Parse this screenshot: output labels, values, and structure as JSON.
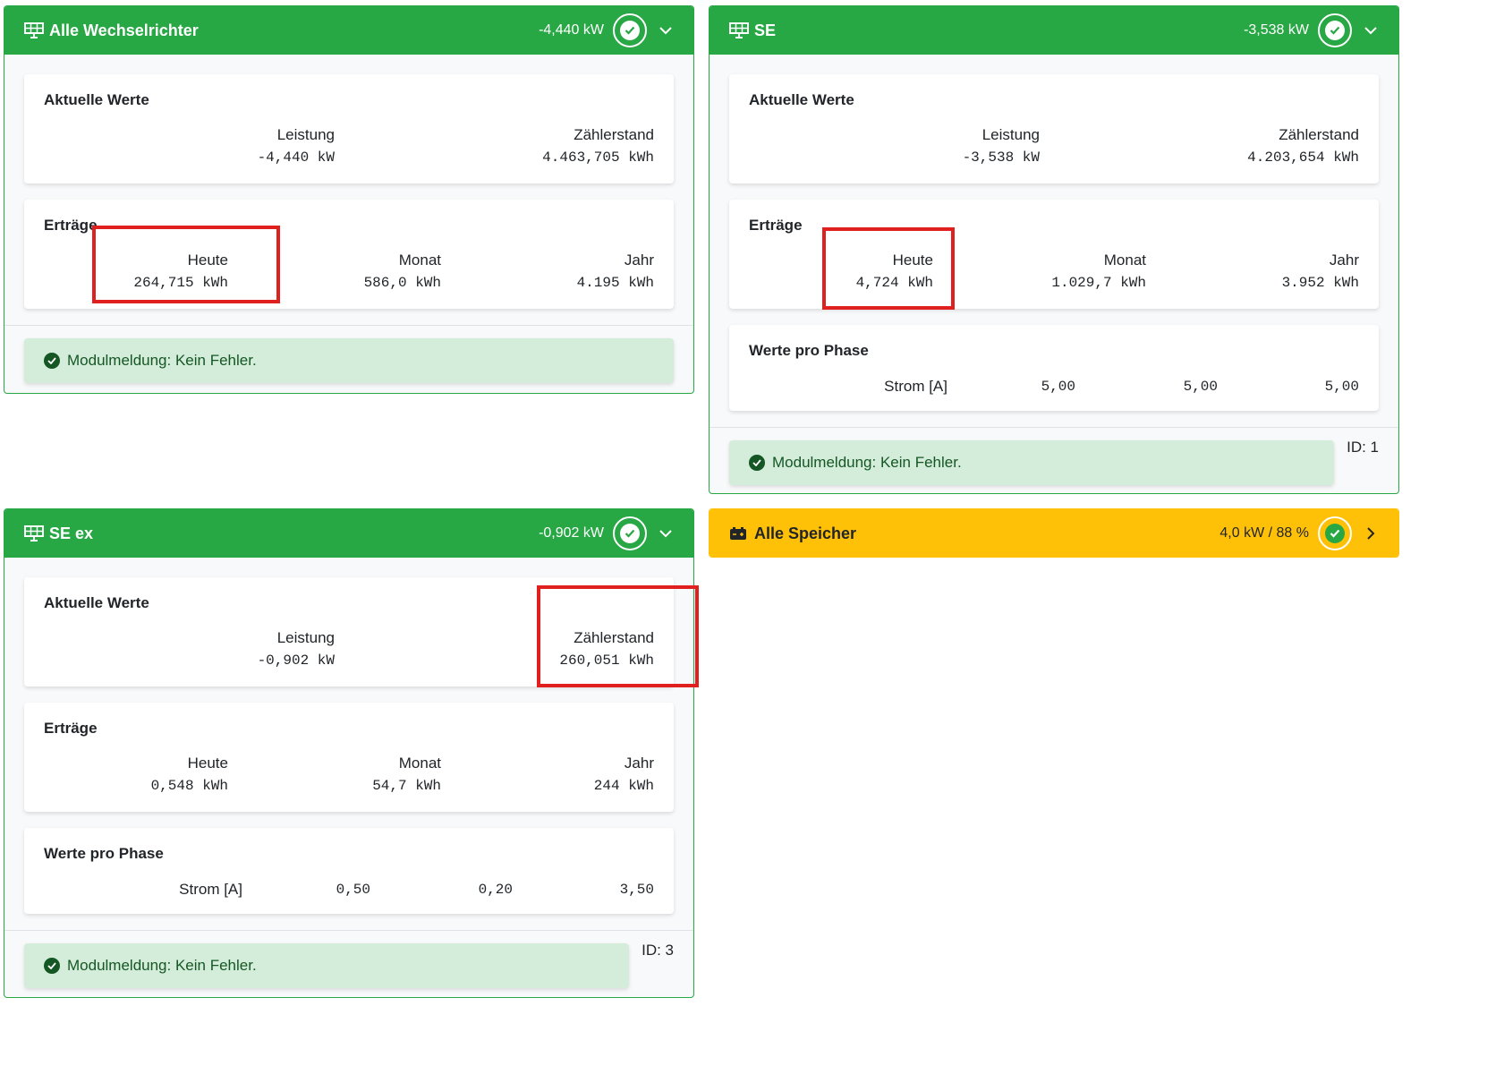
{
  "cards": {
    "all_inverters": {
      "title": "Alle Wechselrichter",
      "power": "-4,440 kW",
      "current": {
        "title": "Aktuelle Werte",
        "power_label": "Leistung",
        "power_value": "-4,440 kW",
        "meter_label": "Zählerstand",
        "meter_value": "4.463,705 kWh"
      },
      "yields": {
        "title": "Erträge",
        "today_label": "Heute",
        "today_value": "264,715 kWh",
        "month_label": "Monat",
        "month_value": "586,0 kWh",
        "year_label": "Jahr",
        "year_value": "4.195 kWh"
      },
      "message": "Modulmeldung: Kein Fehler."
    },
    "se": {
      "title": "SE",
      "power": "-3,538 kW",
      "current": {
        "title": "Aktuelle Werte",
        "power_label": "Leistung",
        "power_value": "-3,538 kW",
        "meter_label": "Zählerstand",
        "meter_value": "4.203,654 kWh"
      },
      "yields": {
        "title": "Erträge",
        "today_label": "Heute",
        "today_value": "4,724 kWh",
        "month_label": "Monat",
        "month_value": "1.029,7 kWh",
        "year_label": "Jahr",
        "year_value": "3.952 kWh"
      },
      "phases": {
        "title": "Werte pro Phase",
        "label": "Strom [A]",
        "values": [
          "5,00",
          "5,00",
          "5,00"
        ]
      },
      "message": "Modulmeldung: Kein Fehler.",
      "id": "ID: 1"
    },
    "se_ex": {
      "title": "SE ex",
      "power": "-0,902 kW",
      "current": {
        "title": "Aktuelle Werte",
        "power_label": "Leistung",
        "power_value": "-0,902 kW",
        "meter_label": "Zählerstand",
        "meter_value": "260,051 kWh"
      },
      "yields": {
        "title": "Erträge",
        "today_label": "Heute",
        "today_value": "0,548 kWh",
        "month_label": "Monat",
        "month_value": "54,7 kWh",
        "year_label": "Jahr",
        "year_value": "244 kWh"
      },
      "phases": {
        "title": "Werte pro Phase",
        "label": "Strom [A]",
        "values": [
          "0,50",
          "0,20",
          "3,50"
        ]
      },
      "message": "Modulmeldung: Kein Fehler.",
      "id": "ID: 3"
    },
    "all_storage": {
      "title": "Alle Speicher",
      "value": "4,0 kW / 88 %"
    }
  },
  "icons": {
    "solar": "solar-panel-icon",
    "battery": "battery-icon",
    "status": "check-circle-icon",
    "expand": "chevron-down-icon",
    "open": "chevron-right-icon"
  },
  "colors": {
    "success": "#28a745",
    "warning": "#ffc107",
    "alert_bg": "#d4edda",
    "alert_text": "#155724",
    "highlight": "#e0201e"
  }
}
